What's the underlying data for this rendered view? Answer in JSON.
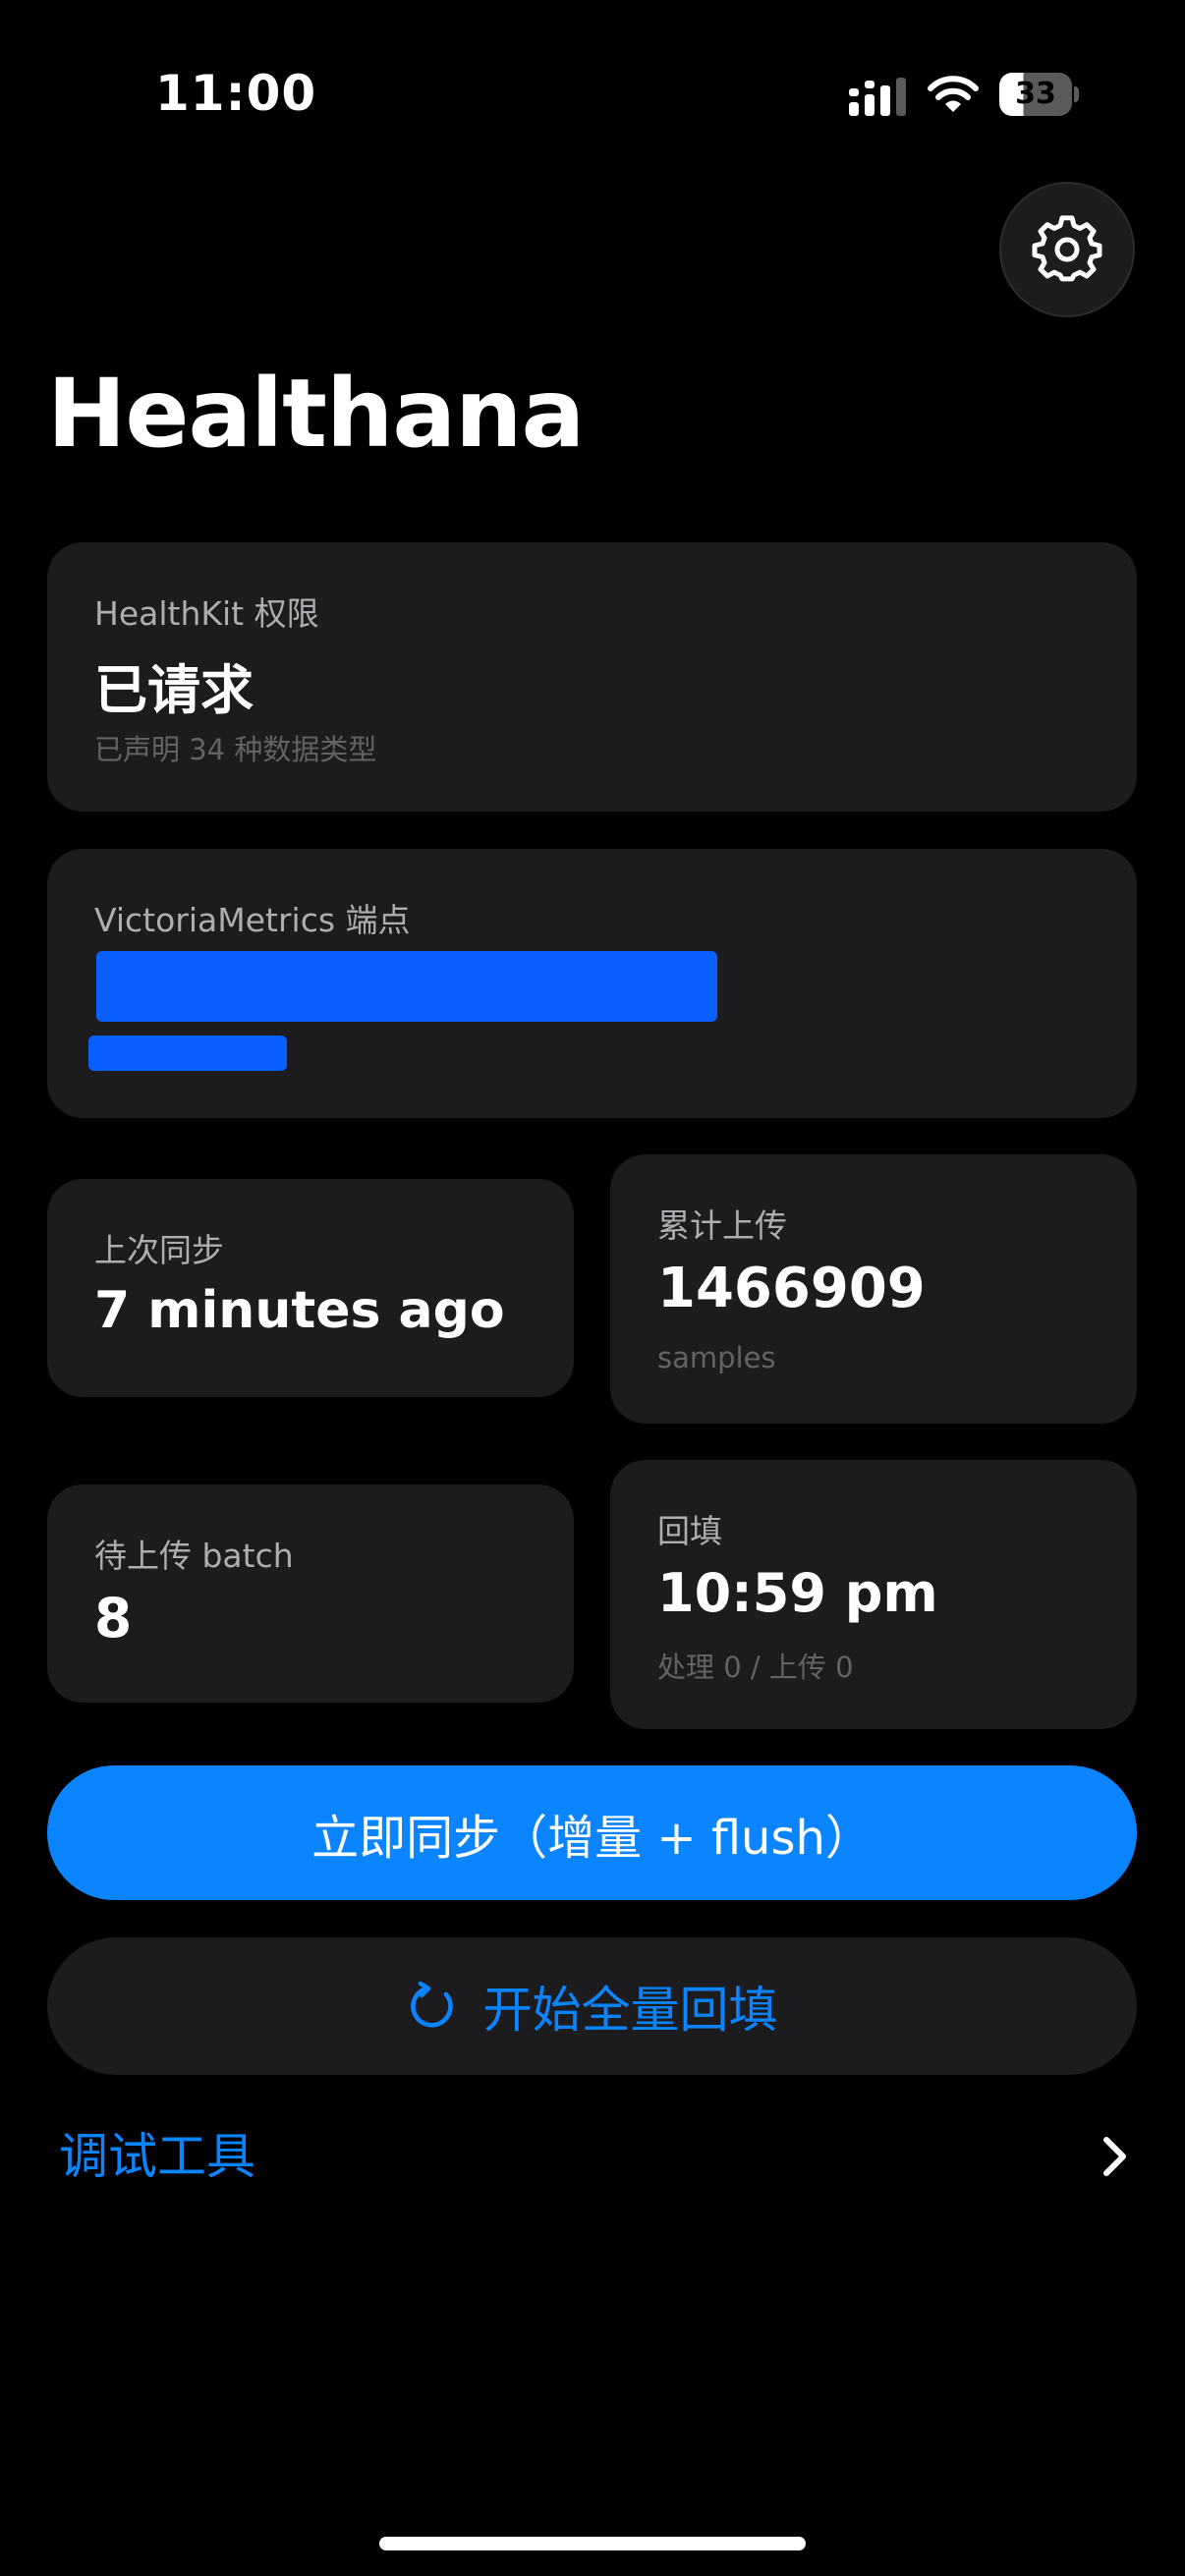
{
  "status_bar": {
    "time": "11:00",
    "battery": "33",
    "icons": [
      "cellular-signal-icon",
      "wifi-icon",
      "battery-icon"
    ]
  },
  "header": {
    "title": "Healthana",
    "settings_icon": "gear-icon"
  },
  "permission_card": {
    "label": "HealthKit 权限",
    "value": "已请求",
    "sub": "已声明 34 种数据类型"
  },
  "endpoint_card": {
    "label": "VictoriaMetrics 端点"
  },
  "last_sync_card": {
    "label": "上次同步",
    "value": "7 minutes ago"
  },
  "total_upload_card": {
    "label": "累计上传",
    "value": "1466909",
    "sub": "samples"
  },
  "pending_card": {
    "label": "待上传 batch",
    "value": "8"
  },
  "backfill_card": {
    "label": "回填",
    "value": "10:59 pm",
    "sub": "处理 0 / 上传 0"
  },
  "actions": {
    "sync_now_label": "立即同步（增量 + flush）",
    "full_backfill_label": "开始全量回填",
    "full_backfill_icon": "refresh-icon"
  },
  "debug": {
    "label": "调试工具",
    "icon": "chevron-right-icon"
  },
  "colors": {
    "background": "#000000",
    "card": "#1c1c1e",
    "accent": "#0a84ff",
    "redaction": "#0a60ff"
  }
}
